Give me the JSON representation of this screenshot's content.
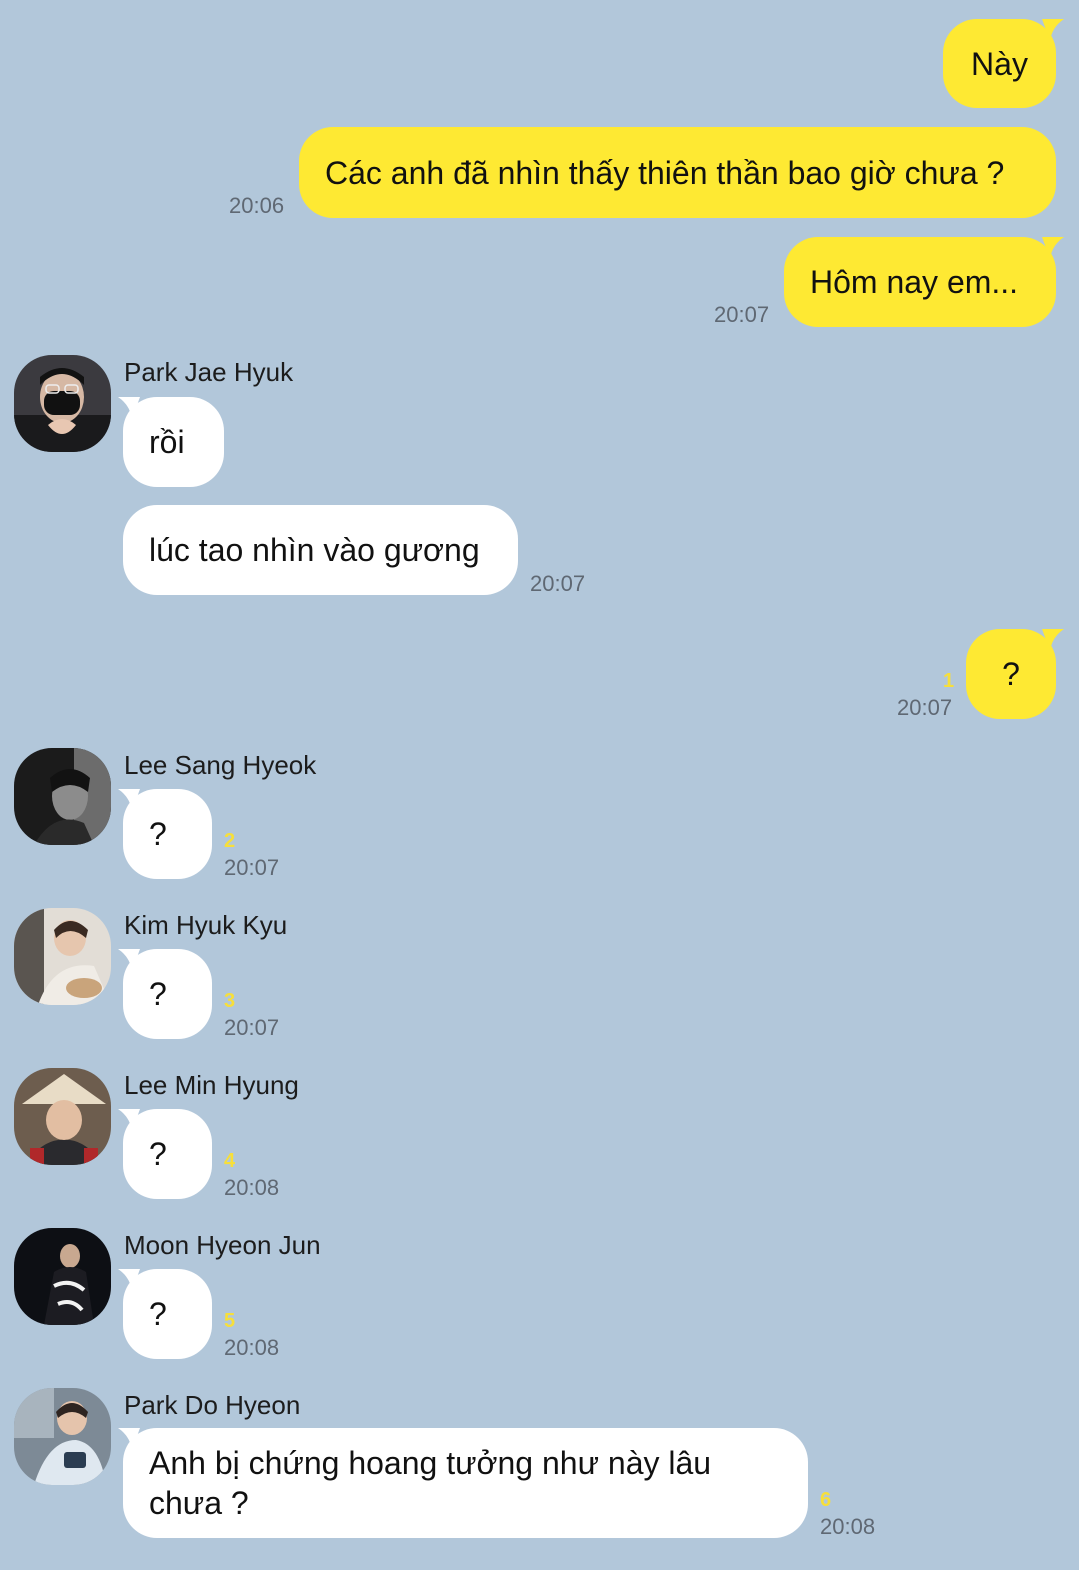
{
  "messages": {
    "m1": {
      "text": "Này"
    },
    "m2": {
      "text": "Các anh đã nhìn thấy thiên thần bao giờ chưa ?",
      "time": "20:06"
    },
    "m3": {
      "text": "Hôm nay em...",
      "time": "20:07"
    },
    "jaehyuk": {
      "name": "Park Jae Hyuk",
      "text1": "rồi",
      "text2": "lúc tao nhìn vào gương",
      "time": "20:07"
    },
    "m4": {
      "text": "?",
      "unread": "1",
      "time": "20:07"
    },
    "sanghyeok": {
      "name": "Lee Sang Hyeok",
      "text": "?",
      "unread": "2",
      "time": "20:07"
    },
    "hyukkyu": {
      "name": "Kim Hyuk Kyu",
      "text": "?",
      "unread": "3",
      "time": "20:07"
    },
    "minhyung": {
      "name": "Lee Min Hyung",
      "text": "?",
      "unread": "4",
      "time": "20:08"
    },
    "hyeonjun": {
      "name": "Moon Hyeon Jun",
      "text": "?",
      "unread": "5",
      "time": "20:08"
    },
    "dohyeon": {
      "name": "Park Do Hyeon",
      "text": "Anh bị chứng hoang tưởng như này lâu chưa ?",
      "unread": "6",
      "time": "20:08"
    }
  },
  "colors": {
    "background": "#b2c7da",
    "my_bubble": "#fee933",
    "their_bubble": "#ffffff",
    "unread_count": "#f7df3a"
  },
  "icons": [
    "avatar-park-jae-hyuk",
    "avatar-lee-sang-hyeok",
    "avatar-kim-hyuk-kyu",
    "avatar-lee-min-hyung",
    "avatar-moon-hyeon-jun",
    "avatar-park-do-hyeon"
  ]
}
